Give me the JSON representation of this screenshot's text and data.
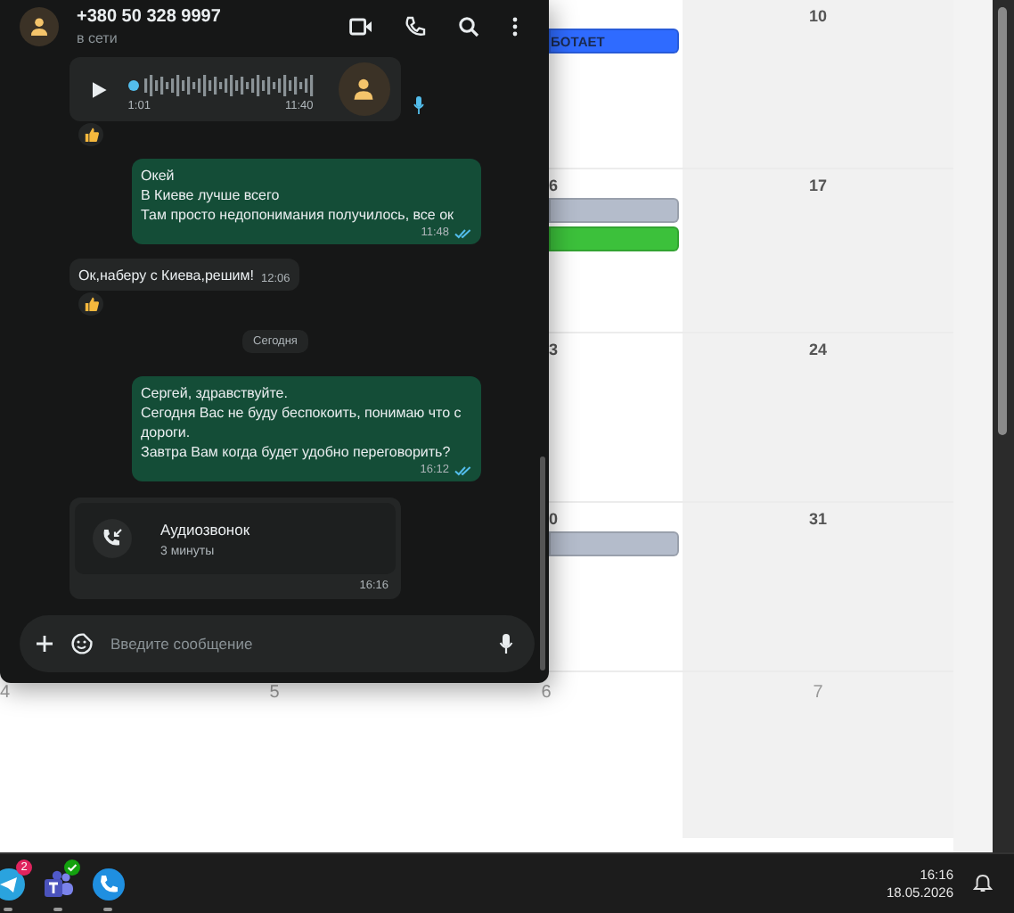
{
  "calendar": {
    "weeks": [
      {
        "events": [
          {
            "label": "БОТАЕТ",
            "color": "#2f6bff"
          }
        ],
        "weekend_day": "10"
      },
      {
        "partial_day": "6",
        "events": [
          {
            "color": "#b4bccb"
          },
          {
            "color": "#3cc13b"
          }
        ],
        "weekend_day": "17"
      },
      {
        "partial_day": "3",
        "weekend_day": "24"
      },
      {
        "partial_day": "0",
        "events": [
          {
            "color": "#b4bccb"
          }
        ],
        "weekend_day": "31"
      }
    ],
    "next_month_days": [
      "4",
      "5",
      "6",
      "7"
    ]
  },
  "chat": {
    "contact": "+380 50 328 9997",
    "status": "в сети",
    "messages": [
      {
        "kind": "voice",
        "outgoing": false,
        "duration": "1:01",
        "time": "11:40",
        "reaction": true
      },
      {
        "kind": "text",
        "outgoing": true,
        "lines": [
          "Окей",
          "В Киеве лучше всего",
          "Там просто недопонимания получилось, все ок"
        ],
        "time": "11:48",
        "read": true,
        "reaction": false
      },
      {
        "kind": "text",
        "outgoing": false,
        "lines": [
          "Ок,наберу с Киева,решим!"
        ],
        "time": "12:06",
        "reaction": true
      },
      {
        "kind": "date",
        "label": "Сегодня"
      },
      {
        "kind": "text",
        "outgoing": true,
        "lines": [
          "Сергей, здравствуйте.",
          "Сегодня Вас не буду беспокоить, понимаю что с дороги.",
          "Завтра Вам когда будет удобно переговорить?"
        ],
        "time": "16:12",
        "read": true,
        "reaction": false
      },
      {
        "kind": "call",
        "outgoing": false,
        "title": "Аудиозвонок",
        "duration": "3 минуты",
        "time": "16:16"
      }
    ],
    "composer": {
      "placeholder": "Введите сообщение"
    }
  },
  "taskbar": {
    "apps": [
      {
        "kind": "telegram",
        "badge": "2"
      },
      {
        "kind": "teams"
      },
      {
        "kind": "phone"
      }
    ],
    "time": "16:16",
    "date": "18.05.2026"
  }
}
